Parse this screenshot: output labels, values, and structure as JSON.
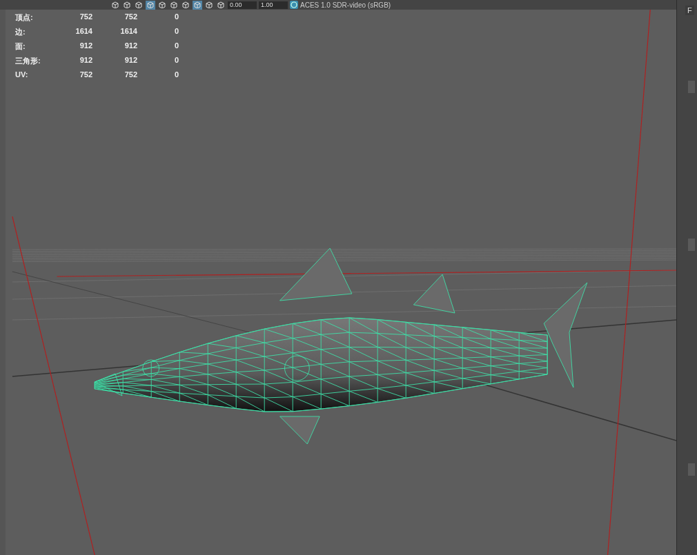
{
  "toolbar": {
    "buttons": [
      {
        "selected": false
      },
      {
        "selected": false
      },
      {
        "selected": false
      },
      {
        "selected": true
      },
      {
        "selected": false
      },
      {
        "selected": false
      },
      {
        "selected": false
      },
      {
        "selected": true
      },
      {
        "selected": false
      },
      {
        "selected": false
      }
    ],
    "fields": [
      {
        "value": "0.00"
      },
      {
        "value": "1.00"
      }
    ],
    "color_space": "ACES 1.0 SDR-video (sRGB)"
  },
  "stats": [
    {
      "label": "顶点:",
      "values": [
        "752",
        "752",
        "0"
      ]
    },
    {
      "label": "边:",
      "values": [
        "1614",
        "1614",
        "0"
      ]
    },
    {
      "label": "面:",
      "values": [
        "912",
        "912",
        "0"
      ]
    },
    {
      "label": "三角形:",
      "values": [
        "912",
        "912",
        "0"
      ]
    },
    {
      "label": "UV:",
      "values": [
        "752",
        "752",
        "0"
      ]
    }
  ],
  "side_panel": {
    "tab": "F"
  }
}
